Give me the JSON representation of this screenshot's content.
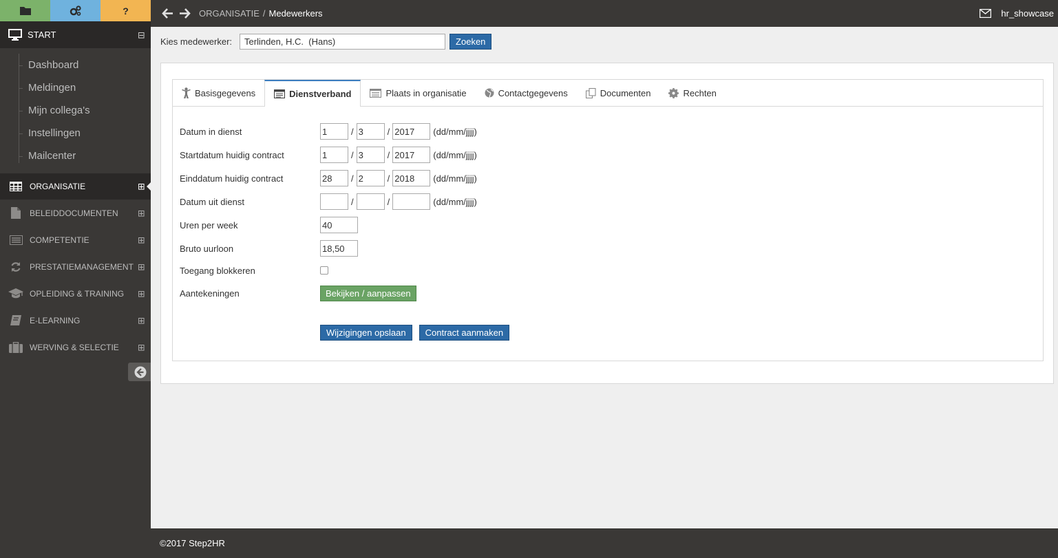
{
  "sidebar": {
    "top_tabs": [
      {
        "icon": "folder-icon",
        "label": ""
      },
      {
        "icon": "gears-icon",
        "label": ""
      },
      {
        "icon": "help-icon",
        "label": "?"
      }
    ],
    "start": {
      "label": "START",
      "toggle": "⊟"
    },
    "sub_items": [
      {
        "label": "Dashboard"
      },
      {
        "label": "Meldingen"
      },
      {
        "label": "Mijn collega's"
      },
      {
        "label": "Instellingen"
      },
      {
        "label": "Mailcenter"
      }
    ],
    "nav_items": [
      {
        "label": "ORGANISATIE",
        "icon": "table-icon",
        "toggle": "⊞",
        "active": true
      },
      {
        "label": "BELEIDDOCUMENTEN",
        "icon": "document-icon",
        "toggle": "⊞"
      },
      {
        "label": "COMPETENTIE",
        "icon": "list-icon",
        "toggle": "⊞"
      },
      {
        "label": "PRESTATIEMANAGEMENT",
        "icon": "refresh-icon",
        "toggle": "⊞"
      },
      {
        "label": "OPLEIDING & TRAINING",
        "icon": "graduation-cap-icon",
        "toggle": "⊞"
      },
      {
        "label": "E-LEARNING",
        "icon": "book-icon",
        "toggle": "⊞"
      },
      {
        "label": "WERVING & SELECTIE",
        "icon": "briefcase-icon",
        "toggle": "⊞"
      }
    ]
  },
  "header": {
    "breadcrumb": {
      "section": "ORGANISATIE",
      "separator": "/",
      "page": "Medewerkers"
    },
    "user": "hr_showcase"
  },
  "search": {
    "label": "Kies medewerker:",
    "value": "Terlinden, H.C.  (Hans)",
    "button": "Zoeken"
  },
  "tabs": [
    {
      "label": "Basisgegevens",
      "icon": "person-icon"
    },
    {
      "label": "Dienstverband",
      "icon": "id-card-icon",
      "active": true
    },
    {
      "label": "Plaats in organisatie",
      "icon": "list-card-icon"
    },
    {
      "label": "Contactgegevens",
      "icon": "globe-icon"
    },
    {
      "label": "Documenten",
      "icon": "copy-icon"
    },
    {
      "label": "Rechten",
      "icon": "cog-icon"
    }
  ],
  "form": {
    "date_format": "(dd/mm/jjjj)",
    "slash": "/",
    "datum_in_dienst": {
      "label": "Datum in dienst",
      "dd": "1",
      "mm": "3",
      "yyyy": "2017"
    },
    "startdatum": {
      "label": "Startdatum huidig contract",
      "dd": "1",
      "mm": "3",
      "yyyy": "2017"
    },
    "einddatum": {
      "label": "Einddatum huidig contract",
      "dd": "28",
      "mm": "2",
      "yyyy": "2018"
    },
    "datum_uit_dienst": {
      "label": "Datum uit dienst",
      "dd": "",
      "mm": "",
      "yyyy": ""
    },
    "uren": {
      "label": "Uren per week",
      "value": "40"
    },
    "uurloon": {
      "label": "Bruto uurloon",
      "value": "18,50"
    },
    "toegang": {
      "label": "Toegang blokkeren",
      "checked": false
    },
    "aantekeningen": {
      "label": "Aantekeningen",
      "button": "Bekijken / aanpassen"
    },
    "save_button": "Wijzigingen opslaan",
    "contract_button": "Contract aanmaken"
  },
  "footer": {
    "text": "©2017 Step2HR"
  },
  "colors": {
    "sidebar_bg": "#3a3836",
    "green_tab": "#7cb26a",
    "blue_tab": "#6fb2de",
    "orange_tab": "#f2b552",
    "primary_button": "#2c6aa6",
    "success_button": "#6aa364"
  }
}
